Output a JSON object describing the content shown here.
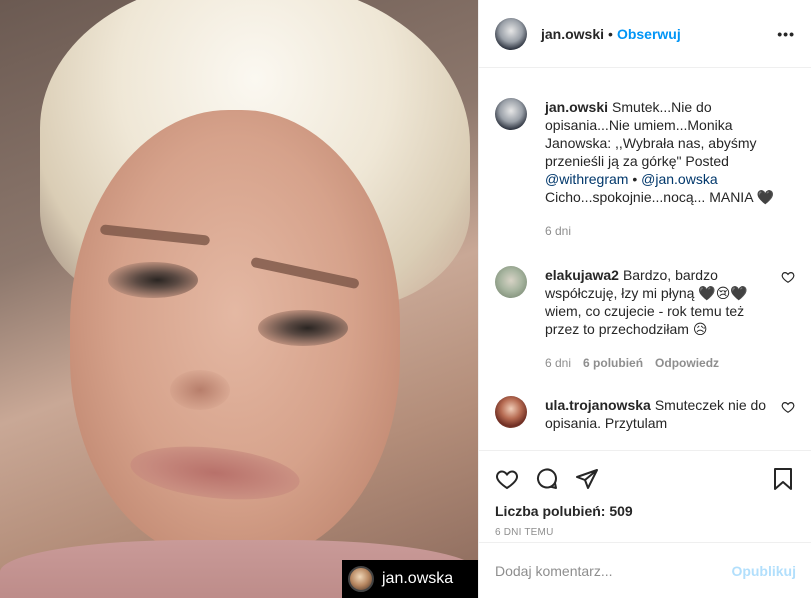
{
  "post": {
    "username": "jan.owski",
    "dot": "•",
    "follow_label": "Obserwuj",
    "more_label": "•••",
    "watermark_text": "jan.owska"
  },
  "caption": {
    "username": "jan.owski",
    "text_1": "Smutek...Nie do opisania...Nie umiem...Monika Janowska: ,,Wybrała nas, abyśmy przenieśli ją za górkę\" Posted",
    "mention_1": "@withregram",
    "bullet": " • ",
    "mention_2": "@jan.owska",
    "text_2": "Cicho...spokojnie...nocą... MANIA 🖤",
    "time": "6 dni"
  },
  "comments": [
    {
      "username": "elakujawa2",
      "text": "Bardzo, bardzo współczuję, łzy mi płyną 🖤😢🖤 wiem, co czujecie - rok temu też przez to przechodziłam 😥",
      "time": "6 dni",
      "likes": "6 polubień",
      "reply": "Odpowiedz"
    },
    {
      "username": "ula.trojanowska",
      "text": "Smuteczek nie do opisania. Przytulam"
    }
  ],
  "actions": {
    "icons": [
      "heart-icon",
      "comment-icon",
      "share-icon",
      "bookmark-icon"
    ],
    "likes_text": "Liczba polubień: 509",
    "time_ago": "6 dni temu"
  },
  "add_comment": {
    "placeholder": "Dodaj komentarz...",
    "publish_label": "Opublikuj"
  },
  "colors": {
    "accent": "#0095f6",
    "publish_disabled": "#b2dffc",
    "mention": "#00376b",
    "muted": "#8e8e8e"
  }
}
